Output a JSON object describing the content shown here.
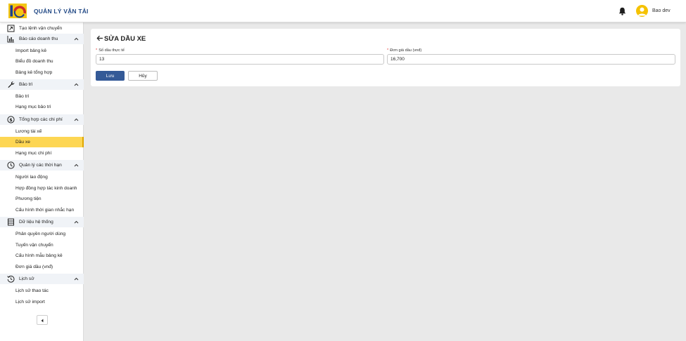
{
  "header": {
    "logo": "logo-icon",
    "app_title": "QUẢN LÝ VẬN TẢI",
    "user_name": "Bao dev"
  },
  "sidebar": {
    "items": [
      {
        "kind": "top",
        "label": "Tạo lệnh vận chuyển",
        "icon": "external-box-icon"
      },
      {
        "kind": "group",
        "label": "Báo cáo doanh thu",
        "icon": "bar-chart-icon"
      },
      {
        "kind": "child",
        "label": "Import bảng kê"
      },
      {
        "kind": "child",
        "label": "Biểu đồ doanh thu"
      },
      {
        "kind": "child",
        "label": "Bảng kê tổng hợp"
      },
      {
        "kind": "group",
        "label": "Bảo trì",
        "icon": "wrench-icon"
      },
      {
        "kind": "child",
        "label": "Bảo trì"
      },
      {
        "kind": "child",
        "label": "Hạng mục bảo trì"
      },
      {
        "kind": "group",
        "label": "Tổng hợp các chi phí",
        "icon": "dollar-icon"
      },
      {
        "kind": "child",
        "label": "Lương tài xế"
      },
      {
        "kind": "child",
        "label": "Dầu xe",
        "active": true
      },
      {
        "kind": "child",
        "label": "Hạng mục chi phí"
      },
      {
        "kind": "group",
        "label": "Quản lý các thời hạn",
        "icon": "clock-icon"
      },
      {
        "kind": "child",
        "label": "Người lao động"
      },
      {
        "kind": "child",
        "label": "Hợp đồng hợp tác kinh doanh"
      },
      {
        "kind": "child",
        "label": "Phương tiện"
      },
      {
        "kind": "child",
        "label": "Cấu hình thời gian nhắc hạn"
      },
      {
        "kind": "group",
        "label": "Dữ liệu hệ thống",
        "icon": "database-icon"
      },
      {
        "kind": "child",
        "label": "Phân quyền người dùng"
      },
      {
        "kind": "child",
        "label": "Tuyến vận chuyển"
      },
      {
        "kind": "child",
        "label": "Cấu hình mẫu bảng kê"
      },
      {
        "kind": "child",
        "label": "Đơn giá dầu (vnđ)"
      },
      {
        "kind": "group",
        "label": "Lịch sử",
        "icon": "history-icon"
      },
      {
        "kind": "child",
        "label": "Lịch sử thao tác"
      },
      {
        "kind": "child",
        "label": "Lịch sử import"
      }
    ]
  },
  "form": {
    "title": "SỬA DẦU XE",
    "fields": {
      "actual_oil": {
        "label": "Số dầu thực tế",
        "value": "13"
      },
      "oil_price": {
        "label": "Đơn giá dầu (vnđ)",
        "value": "16,700"
      }
    },
    "save_label": "Lưu",
    "cancel_label": "Hủy"
  },
  "colors": {
    "accent": "#345a97",
    "active_item": "#fdd653",
    "title_blue": "#234a86",
    "avatar": "#f5c200"
  }
}
